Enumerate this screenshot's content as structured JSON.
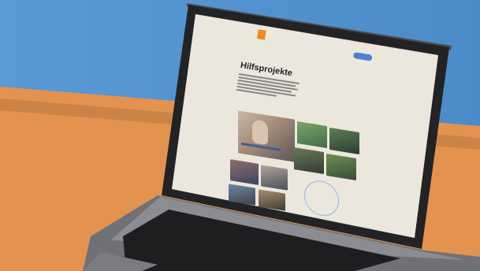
{
  "page": {
    "title": "Hilfsprojekte"
  },
  "colors": {
    "wall": "#4f93d3",
    "table": "#e3934f",
    "laptop": "#232325",
    "screen_bg": "#ece7dc",
    "brand_orange": "#f08a22",
    "brand_blue": "#4f7fd0"
  },
  "icons": {
    "camera": "camera-icon"
  }
}
